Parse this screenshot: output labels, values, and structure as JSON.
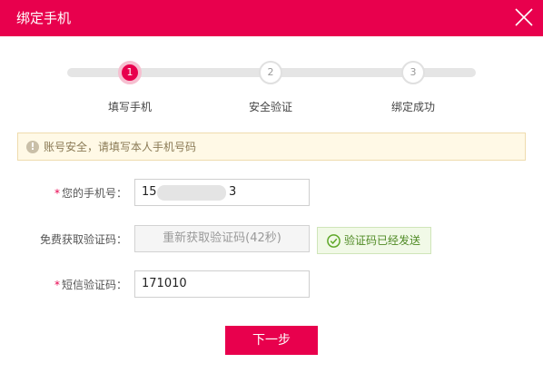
{
  "dialog": {
    "title": "绑定手机",
    "accent_color": "#e8004d"
  },
  "steps": [
    {
      "number": "1",
      "label": "填写手机",
      "active": true
    },
    {
      "number": "2",
      "label": "安全验证",
      "active": false
    },
    {
      "number": "3",
      "label": "绑定成功",
      "active": false
    }
  ],
  "notice": {
    "icon": "exclamation-circle-icon",
    "text": "账号安全，请填写本人手机号码"
  },
  "form": {
    "phone": {
      "required_mark": "*",
      "label": "您的手机号：",
      "value_prefix": "15",
      "value_suffix": "3"
    },
    "sms_code_request": {
      "label": "免费获取验证码：",
      "button_label": "重新获取验证码(42秒)",
      "status_text": "验证码已经发送",
      "status_icon": "check-circle-icon"
    },
    "sms_code": {
      "required_mark": "*",
      "label": "短信验证码：",
      "value": "171010"
    }
  },
  "actions": {
    "next_label": "下一步"
  }
}
